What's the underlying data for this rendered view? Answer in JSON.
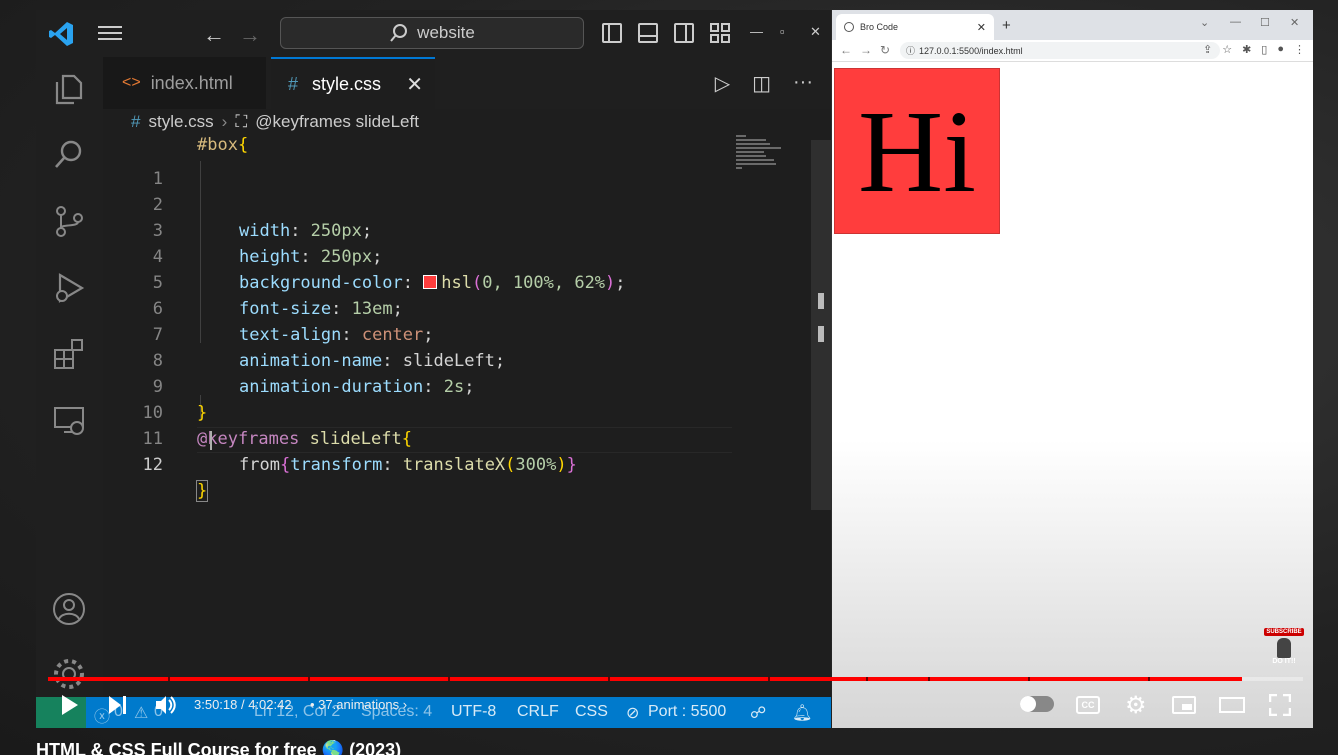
{
  "vscode": {
    "search_text": "website",
    "tabs": [
      {
        "label": "index.html",
        "icon": "html-file-icon"
      },
      {
        "label": "style.css",
        "icon": "css-file-icon"
      }
    ],
    "breadcrumb": {
      "file": "style.css",
      "symbol": "@keyframes slideLeft"
    },
    "code_lines": [
      {
        "n": "1"
      },
      {
        "n": "2"
      },
      {
        "n": "3"
      },
      {
        "n": "4"
      },
      {
        "n": "5"
      },
      {
        "n": "6"
      },
      {
        "n": "7"
      },
      {
        "n": "8"
      },
      {
        "n": "9"
      },
      {
        "n": "10"
      },
      {
        "n": "11"
      },
      {
        "n": "12"
      }
    ],
    "code": {
      "l1_sel": "#box",
      "l2_prop": "width",
      "l2_val": "250px",
      "l3_prop": "height",
      "l3_val": "250px",
      "l4_prop": "background-color",
      "l4_fn": "hsl",
      "l4_args": "0, 100%, 62%",
      "l5_prop": "font-size",
      "l5_val": "13em",
      "l6_prop": "text-align",
      "l6_val": "center",
      "l7_prop": "animation-name",
      "l7_val": "slideLeft",
      "l8_prop": "animation-duration",
      "l8_val": "2s",
      "l10_at": "@keyframes",
      "l10_name": "slideLeft",
      "l11_from": "from",
      "l11_prop": "transform",
      "l11_fn": "translateX",
      "l11_arg": "300%"
    },
    "status": {
      "errors": "0",
      "warnings": "0",
      "position": "Ln 12, Col 2",
      "spaces": "Spaces: 4",
      "encoding": "UTF-8",
      "eol": "CRLF",
      "language": "CSS",
      "port": "Port : 5500"
    }
  },
  "browser": {
    "tab_title": "Bro Code",
    "url": "127.0.0.1:5500/index.html",
    "box_text": "Hi",
    "box_color": "#ff3d3d"
  },
  "player": {
    "time": "3:50:18 / 4:02:42",
    "chapter": "• 37.animations",
    "progress_fraction": 0.951,
    "title": "HTML & CSS Full Course for free 🌎 (2023)",
    "subscribe_badge": "SUBSCRIBE",
    "subscribe_sub": "DO IT!!"
  }
}
